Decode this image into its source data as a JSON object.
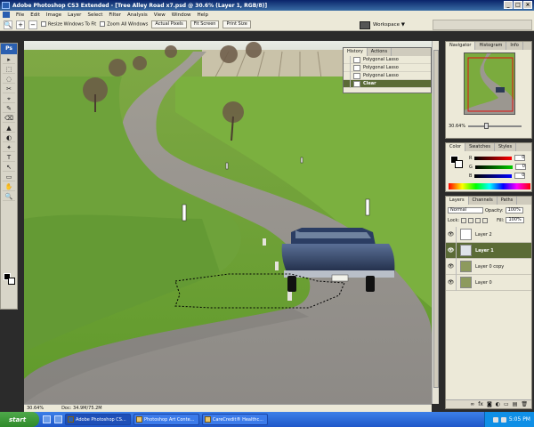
{
  "window": {
    "title": "Adobe Photoshop CS3 Extended - [Tree Alley Road x7.psd @ 30.6% (Layer 1, RGB/8)]",
    "controls": [
      "_",
      "□",
      "×"
    ]
  },
  "menu": [
    "File",
    "Edit",
    "Image",
    "Layer",
    "Select",
    "Filter",
    "Analysis",
    "View",
    "Window",
    "Help"
  ],
  "options": {
    "resize_label": "Resize Windows To Fit",
    "zoom_all_label": "Zoom All Windows",
    "actual_pixels": "Actual Pixels",
    "fit_screen": "Fit Screen",
    "print_size": "Print Size",
    "workspace": "Workspace ▼"
  },
  "toolbox": {
    "logo": "Ps",
    "tools": [
      "▸",
      "⬚",
      "◌",
      "✂",
      "⌖",
      "✎",
      "⌫",
      "▲",
      "◐",
      "✦",
      "T",
      "↖",
      "▭",
      "✋",
      "🔍"
    ]
  },
  "history": {
    "tabs": [
      "History",
      "Actions"
    ],
    "items": [
      "Polygonal Lasso",
      "Polygonal Lasso",
      "Polygonal Lasso",
      "Clear"
    ],
    "current_index": 3
  },
  "navigator": {
    "tabs": [
      "Navigator",
      "Histogram",
      "Info"
    ],
    "zoom": "30.64%"
  },
  "color": {
    "tabs": [
      "Color",
      "Swatches",
      "Styles"
    ],
    "channels": [
      {
        "label": "R",
        "value": "0",
        "gradient": "#ff0000"
      },
      {
        "label": "G",
        "value": "0",
        "gradient": "#00cc00"
      },
      {
        "label": "B",
        "value": "0",
        "gradient": "#0000ff"
      }
    ]
  },
  "layers": {
    "tabs": [
      "Layers",
      "Channels",
      "Paths"
    ],
    "blend_mode": "Normal",
    "opacity_label": "Opacity:",
    "opacity": "100%",
    "lock_label": "Lock:",
    "fill_label": "Fill:",
    "fill": "100%",
    "items": [
      {
        "name": "Layer 2",
        "selected": false
      },
      {
        "name": "Layer 1",
        "selected": true
      },
      {
        "name": "Layer 0 copy",
        "selected": false
      },
      {
        "name": "Layer 0",
        "selected": false
      }
    ],
    "footer_icons": [
      "∞",
      "fx",
      "◙",
      "◐",
      "▭",
      "▤",
      "🗑"
    ]
  },
  "status": {
    "zoom": "30.64%",
    "doc": "Doc: 34.9M/75.2M"
  },
  "taskbar": {
    "start": "start",
    "tasks": [
      "Adobe Photoshop CS...",
      "Photoshop Art Conte...",
      "CareCredit® Healthc..."
    ],
    "active_index": 0,
    "clock": "5:05 PM"
  },
  "colors": {
    "panel": "#ece9d8",
    "selected_row": "#5b6b36",
    "title_bar": "#0a246a",
    "grass": "#6f9a3a",
    "road": "#8c8a86",
    "car": "#2c3a55"
  }
}
